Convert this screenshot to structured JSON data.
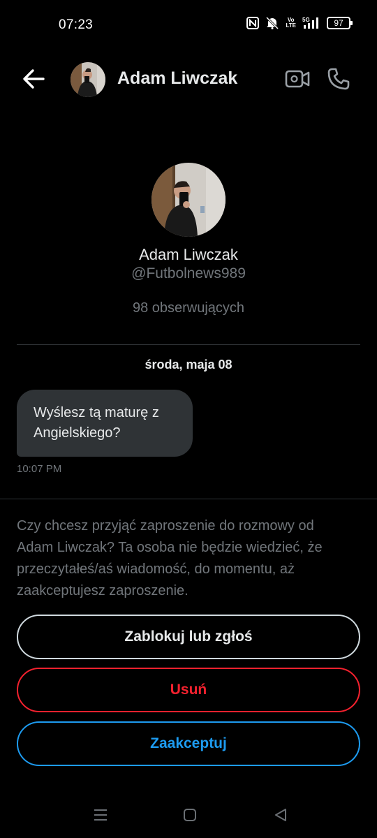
{
  "status_bar": {
    "time": "07:23",
    "volte_label": "Vo\nLTE",
    "network_label": "5G",
    "battery": "97"
  },
  "header": {
    "contact_name": "Adam Liwczak",
    "icons": [
      "back-arrow-icon",
      "video-camera-icon",
      "phone-icon"
    ]
  },
  "profile": {
    "name": "Adam Liwczak",
    "handle": "@Futbolnews989",
    "followers": "98 obserwujących"
  },
  "conversation": {
    "date_separator": "środa, maja 08",
    "messages": [
      {
        "text": "Wyślesz tą maturę z Angielskiego?",
        "time": "10:07 PM"
      }
    ]
  },
  "invite": {
    "text": "Czy chcesz przyjąć zaproszenie do rozmowy od Adam Liwczak? Ta osoba nie będzie wiedzieć, że przeczytałeś/aś wiadomość, do momentu, aż zaakceptujesz zaproszenie.",
    "block_label": "Zablokuj lub zgłoś",
    "delete_label": "Usuń",
    "accept_label": "Zaakceptuj"
  },
  "colors": {
    "background": "#000000",
    "bubble": "#2f3336",
    "muted_text": "#71767b",
    "danger": "#f4212e",
    "accent": "#1d9bf0"
  },
  "nav_bar": {
    "icons": [
      "recent-apps-icon",
      "home-icon",
      "back-triangle-icon"
    ]
  }
}
